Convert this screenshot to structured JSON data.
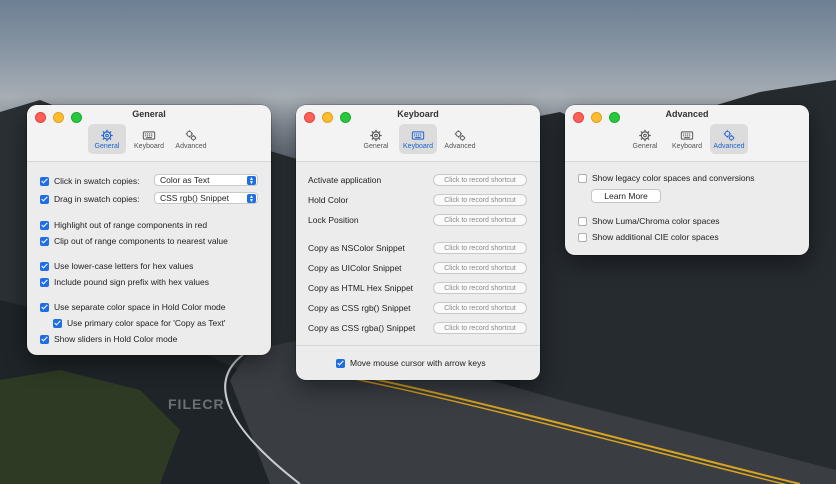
{
  "windows": {
    "general": {
      "title": "General",
      "tabs": [
        {
          "label": "General",
          "active": true,
          "icon": "gear-icon"
        },
        {
          "label": "Keyboard",
          "active": false,
          "icon": "keyboard-icon"
        },
        {
          "label": "Advanced",
          "active": false,
          "icon": "gears-icon"
        }
      ],
      "rows": {
        "click_label": "Click in swatch copies:",
        "click_value": "Color as Text",
        "drag_label": "Drag in swatch copies:",
        "drag_value": "CSS rgb() Snippet",
        "highlight": "Highlight out of range components in red",
        "clip": "Clip out of range components to nearest value",
        "lowercase": "Use lower-case letters for hex values",
        "pound": "Include pound sign prefix with hex values",
        "separate": "Use separate color space in Hold Color mode",
        "primary": "Use primary color space for 'Copy as Text'",
        "sliders": "Show sliders in Hold Color mode"
      }
    },
    "keyboard": {
      "title": "Keyboard",
      "tabs": [
        {
          "label": "General",
          "active": false,
          "icon": "gear-icon"
        },
        {
          "label": "Keyboard",
          "active": true,
          "icon": "keyboard-icon"
        },
        {
          "label": "Advanced",
          "active": false,
          "icon": "gears-icon"
        }
      ],
      "shortcut_placeholder": "Click to record shortcut",
      "actions": [
        "Activate application",
        "Hold Color",
        "Lock Position",
        "Copy as NSColor Snippet",
        "Copy as UIColor Snippet",
        "Copy as HTML Hex Snippet",
        "Copy as CSS rgb() Snippet",
        "Copy as CSS rgba() Snippet"
      ],
      "move_cursor": "Move mouse cursor with arrow keys"
    },
    "advanced": {
      "title": "Advanced",
      "tabs": [
        {
          "label": "General",
          "active": false,
          "icon": "gear-icon"
        },
        {
          "label": "Keyboard",
          "active": false,
          "icon": "keyboard-icon"
        },
        {
          "label": "Advanced",
          "active": true,
          "icon": "gears-icon"
        }
      ],
      "legacy": "Show legacy color spaces and conversions",
      "learn_more": "Learn More",
      "luma": "Show Luma/Chroma color spaces",
      "cie": "Show additional CIE color spaces"
    }
  },
  "watermark": "FILECR",
  "colors": {
    "accent": "#1f6ee5",
    "window_bg": "#ececec",
    "active_tab_text": "#1d63d0"
  }
}
